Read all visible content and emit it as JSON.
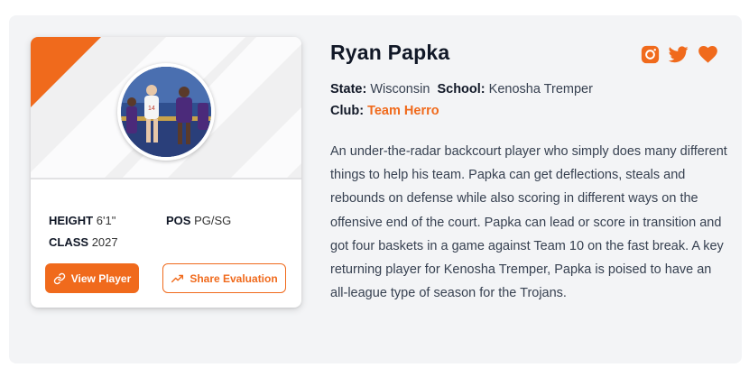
{
  "player": {
    "name": "Ryan Papka",
    "state_label": "State:",
    "state": "Wisconsin",
    "school_label": "School:",
    "school": "Kenosha Tremper",
    "club_label": "Club:",
    "club": "Team Herro",
    "height_label": "HEIGHT",
    "height": "6'1\"",
    "pos_label": "POS",
    "pos": "PG/SG",
    "class_label": "CLASS",
    "class": "2027",
    "bio": "An under-the-radar backcourt player who simply does many different things to help his team. Papka can get deflections, steals and rebounds on defense while also scoring in different ways on the offensive end of the court. Papka can lead or score in transition and got four baskets in a game against Team 10 on the fast break. A key returning player for Kenosha Tremper, Papka is poised to have an all-league type of season for the Trojans."
  },
  "buttons": {
    "view_player": "View Player",
    "share_evaluation": "Share Evaluation"
  },
  "icons": {
    "social": [
      "instagram-icon",
      "twitter-icon",
      "heart-icon"
    ],
    "view": "link-icon",
    "share": "trending-up-icon"
  },
  "colors": {
    "accent": "#f06a1c",
    "background": "#f3f4f6"
  }
}
